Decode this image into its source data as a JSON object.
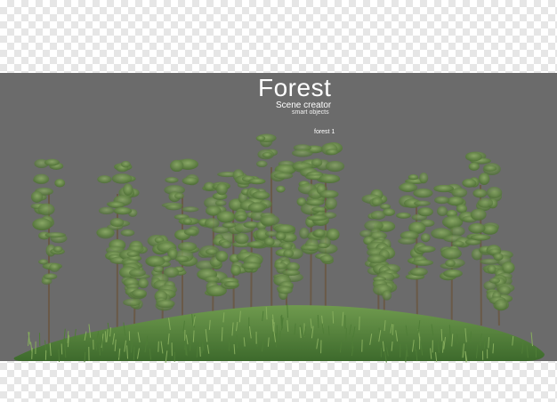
{
  "header": {
    "title": "Forest",
    "subtitle": "Scene creator",
    "caption": "smart objects"
  },
  "scene": {
    "label": "forest 1"
  },
  "colors": {
    "panel": "#6b6b6b",
    "checker_light": "#ffffff",
    "checker_dark": "#e6e6e6",
    "grass": "#4e7a3a",
    "foliage": "#5e7d42",
    "trunk": "#6a5a48"
  }
}
